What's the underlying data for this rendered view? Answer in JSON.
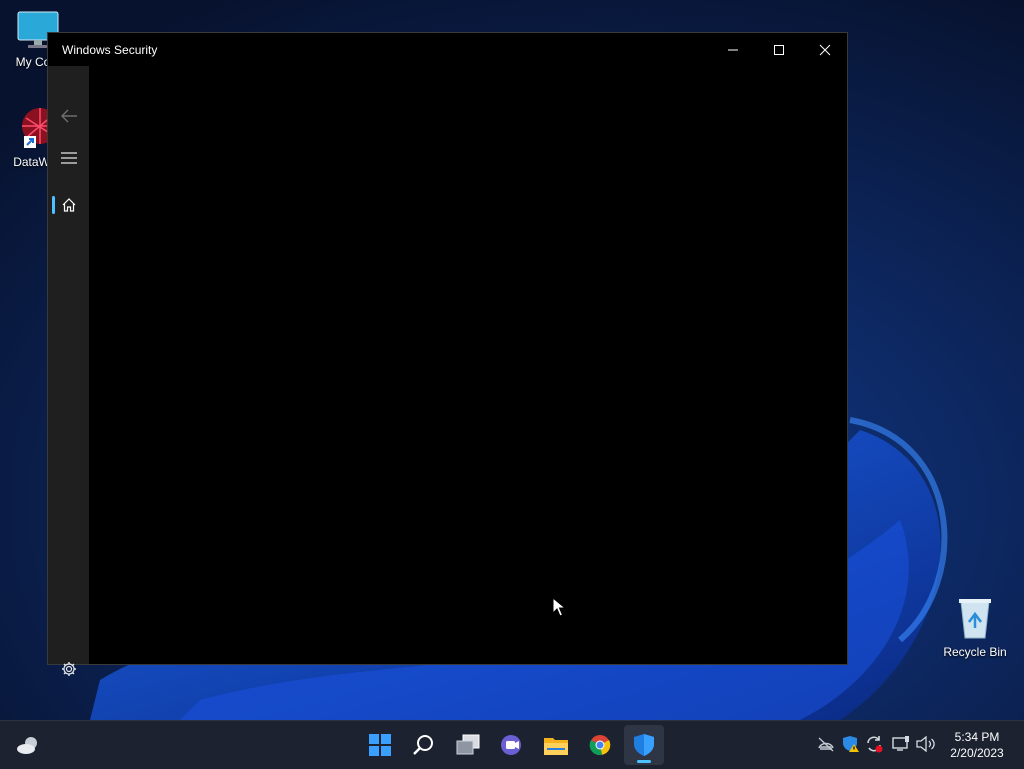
{
  "desktop": {
    "icons": [
      {
        "label": "My Com"
      },
      {
        "label": "DataWag"
      },
      {
        "label": "Recycle Bin"
      }
    ]
  },
  "window": {
    "title": "Windows Security",
    "controls": {
      "minimize_icon": "minimize-icon",
      "maximize_icon": "maximize-icon",
      "close_icon": "close-icon"
    },
    "nav": {
      "items": [
        {
          "icon": "back-arrow-icon"
        },
        {
          "icon": "hamburger-menu-icon"
        },
        {
          "icon": "home-icon",
          "selected": true
        },
        {
          "icon": "gear-icon"
        }
      ]
    }
  },
  "taskbar": {
    "apps": [
      {
        "icon": "weather-icon"
      },
      {
        "icon": "windows-start-icon"
      },
      {
        "icon": "search-icon"
      },
      {
        "icon": "task-view-icon"
      },
      {
        "icon": "chat-icon"
      },
      {
        "icon": "file-explorer-icon"
      },
      {
        "icon": "chrome-icon"
      },
      {
        "icon": "windows-security-icon",
        "active": true
      }
    ],
    "tray": {
      "icons": [
        "network-offline-icon",
        "security-warning-icon",
        "update-icon",
        "display-icon",
        "volume-icon"
      ],
      "time": "5:34 PM",
      "date": "2/20/2023"
    }
  },
  "colors": {
    "accent": "#4cc2ff",
    "window_bg": "#000000",
    "nav_bg": "#1f1f1f",
    "taskbar_bg": "#1c2230"
  }
}
